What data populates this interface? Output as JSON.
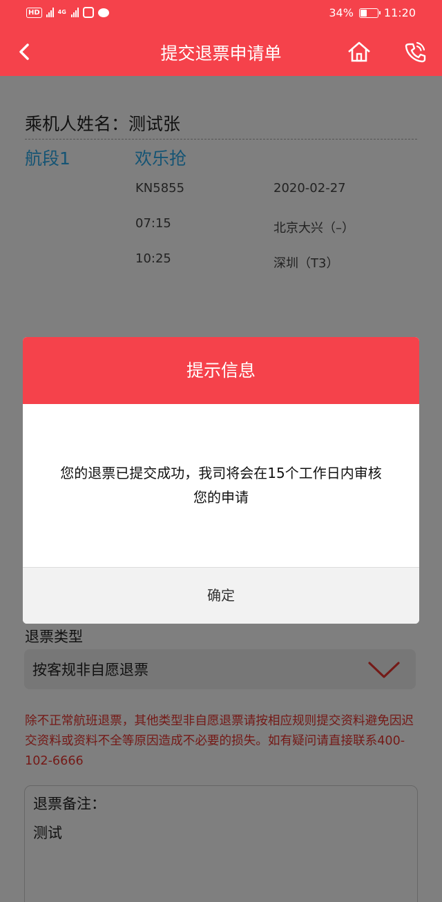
{
  "status_bar": {
    "hd_label": "HD",
    "net_label": "4G",
    "battery_text": "34%",
    "battery_level": 0.34,
    "time": "11:20"
  },
  "header": {
    "title": "提交退票申请单",
    "back_icon": "chevron-left-icon",
    "home_icon": "home-icon",
    "phone_icon": "phone-icon"
  },
  "passenger": {
    "label": "乘机人姓名：测试张"
  },
  "segment": {
    "label": "航段1",
    "airline": "欢乐抢",
    "flight_no": "KN5855",
    "date": "2020-02-27",
    "dep_time": "07:15",
    "dep_airport": "北京大兴（–）",
    "arr_time": "10:25",
    "arr_airport": "深圳（T3）"
  },
  "refund": {
    "type_label": "退票类型",
    "type_value": "按客规非自愿退票",
    "warning": "除不正常航班退票，其他类型非自愿退票请按相应规则提交资料避免因迟交资料或资料不全等原因造成不必要的损失。如有疑问请直接联系400-102-6666",
    "remarks_label": "退票备注：",
    "remarks_value": "测试"
  },
  "dialog": {
    "title": "提示信息",
    "message": "您的退票已提交成功，我司将会在15个工作日内审核您的申请",
    "confirm_label": "确定"
  },
  "colors": {
    "brand_red": "#f5424b",
    "link_blue": "#2aa8e8",
    "warning_red": "#e8352f"
  }
}
